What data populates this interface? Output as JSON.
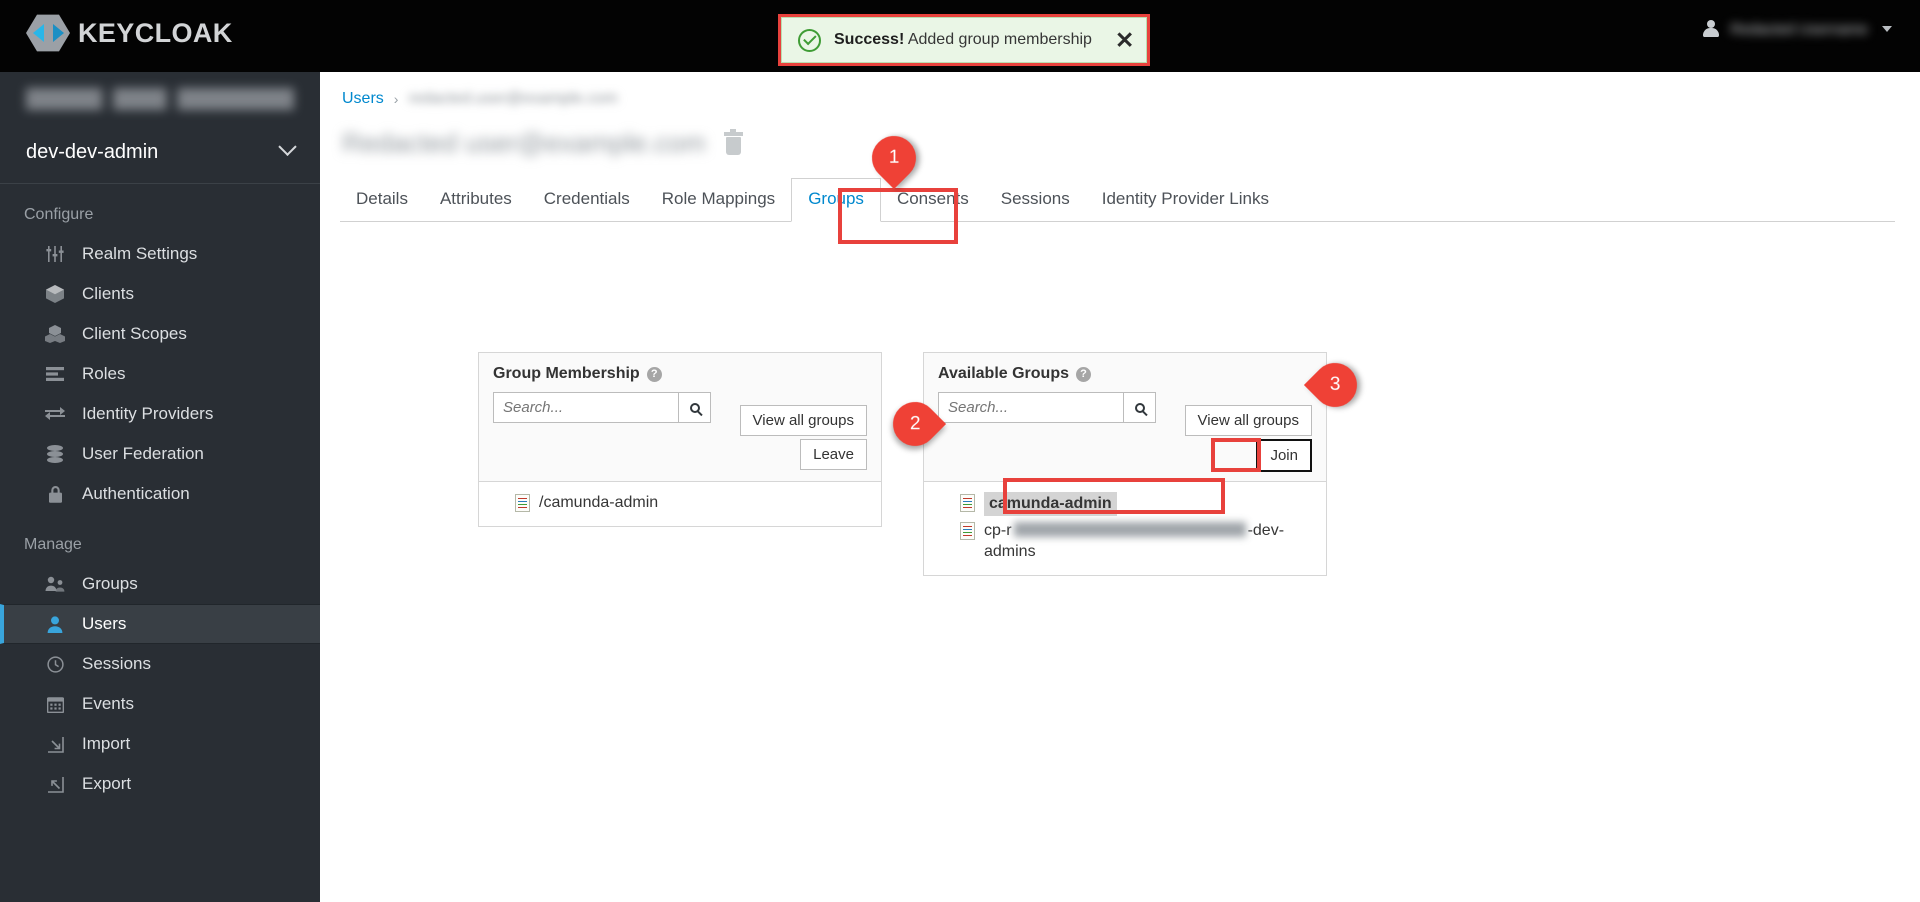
{
  "app": {
    "brand": "KEYCLOAK",
    "user_menu": {
      "name_redacted": true,
      "caret_icon": "chevron-down-icon"
    }
  },
  "alert": {
    "strong": "Success!",
    "message": " Added group membership",
    "close_label": "✕",
    "icon": "check-circle-icon",
    "border_color": "#e8413c",
    "bg_color": "#eaf6e6"
  },
  "sidebar": {
    "realm_selector": {
      "label": "dev-dev-admin",
      "icon": "chevron-down-icon"
    },
    "sections": [
      {
        "label": "Configure",
        "items": [
          {
            "label": "Realm Settings",
            "icon": "sliders-icon",
            "active": false
          },
          {
            "label": "Clients",
            "icon": "cube-icon",
            "active": false
          },
          {
            "label": "Client Scopes",
            "icon": "cubes-icon",
            "active": false
          },
          {
            "label": "Roles",
            "icon": "list-icon",
            "active": false
          },
          {
            "label": "Identity Providers",
            "icon": "exchange-icon",
            "active": false
          },
          {
            "label": "User Federation",
            "icon": "database-icon",
            "active": false
          },
          {
            "label": "Authentication",
            "icon": "lock-icon",
            "active": false
          }
        ]
      },
      {
        "label": "Manage",
        "items": [
          {
            "label": "Groups",
            "icon": "users-icon",
            "active": false
          },
          {
            "label": "Users",
            "icon": "user-icon",
            "active": true
          },
          {
            "label": "Sessions",
            "icon": "clock-icon",
            "active": false
          },
          {
            "label": "Events",
            "icon": "calendar-icon",
            "active": false
          },
          {
            "label": "Import",
            "icon": "import-icon",
            "active": false
          },
          {
            "label": "Export",
            "icon": "export-icon",
            "active": false
          }
        ]
      }
    ],
    "active_accent": "#39a5dc"
  },
  "main": {
    "breadcrumb": {
      "root": "Users",
      "separator": "›",
      "current_redacted": true
    },
    "page_title_redacted": true,
    "delete_icon": "trash-icon",
    "tabs": [
      {
        "label": "Details",
        "active": false
      },
      {
        "label": "Attributes",
        "active": false
      },
      {
        "label": "Credentials",
        "active": false
      },
      {
        "label": "Role Mappings",
        "active": false
      },
      {
        "label": "Groups",
        "active": true
      },
      {
        "label": "Consents",
        "active": false
      },
      {
        "label": "Sessions",
        "active": false
      },
      {
        "label": "Identity Provider Links",
        "active": false
      }
    ],
    "membership_panel": {
      "title": "Group Membership",
      "help_icon": "question-circle-icon",
      "search_placeholder": "Search...",
      "search_value": "",
      "search_icon": "search-icon",
      "view_all_label": "View all groups",
      "action_label": "Leave",
      "items": [
        {
          "label": "/camunda-admin",
          "icon": "group-file-icon",
          "selected": false,
          "redacted": false
        }
      ]
    },
    "available_panel": {
      "title": "Available Groups",
      "help_icon": "question-circle-icon",
      "search_placeholder": "Search...",
      "search_value": "",
      "search_icon": "search-icon",
      "view_all_label": "View all groups",
      "action_label": "Join",
      "items": [
        {
          "label": "camunda-admin",
          "icon": "group-file-icon",
          "selected": true,
          "redacted": false
        },
        {
          "prefix": "cp-r",
          "suffix": "-dev-admins",
          "icon": "group-file-icon",
          "selected": false,
          "redacted": true
        }
      ]
    }
  },
  "annotations": {
    "pin_color": "#ef4136",
    "highlight_color": "#e8413c",
    "pins": [
      {
        "number": "1",
        "target": "groups-tab",
        "direction": "down"
      },
      {
        "number": "2",
        "target": "available-group-camunda-admin",
        "direction": "right"
      },
      {
        "number": "3",
        "target": "join-button",
        "direction": "left"
      }
    ]
  }
}
